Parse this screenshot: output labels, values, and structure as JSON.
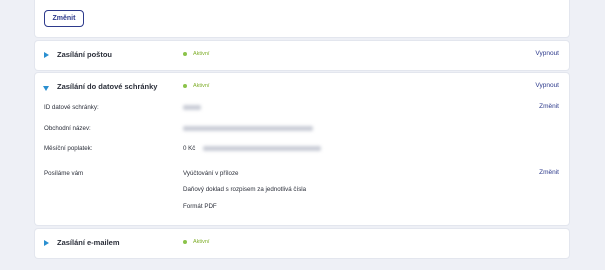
{
  "top": {
    "change_label": "Změnit"
  },
  "sections": [
    {
      "title": "Zasílání poštou",
      "status": "Aktivní",
      "action": "Vypnout"
    },
    {
      "title": "Zasílání do datové schránky",
      "status": "Aktivní",
      "action": "Vypnout",
      "rows": [
        {
          "label": "ID datové schránky:",
          "change": "Změnit"
        },
        {
          "label": "Obchodní název:"
        },
        {
          "label": "Měsíční poplatek:",
          "value": "0 Kč"
        }
      ],
      "sending": {
        "label": "Posíláme vám",
        "change": "Změnit",
        "items": [
          "Vyúčtování v příloze",
          "Daňový doklad s rozpisem za jednotlivá čísla",
          "Formát PDF"
        ]
      }
    },
    {
      "title": "Zasílání e-mailem",
      "status": "Aktivní"
    }
  ],
  "colors": {
    "accent": "#2a8fd0",
    "link": "#2d3a8c",
    "active": "#8bc34a"
  },
  "icons": {
    "collapsed": "caret-right-icon",
    "expanded": "caret-down-icon",
    "status": "status-dot-icon"
  }
}
